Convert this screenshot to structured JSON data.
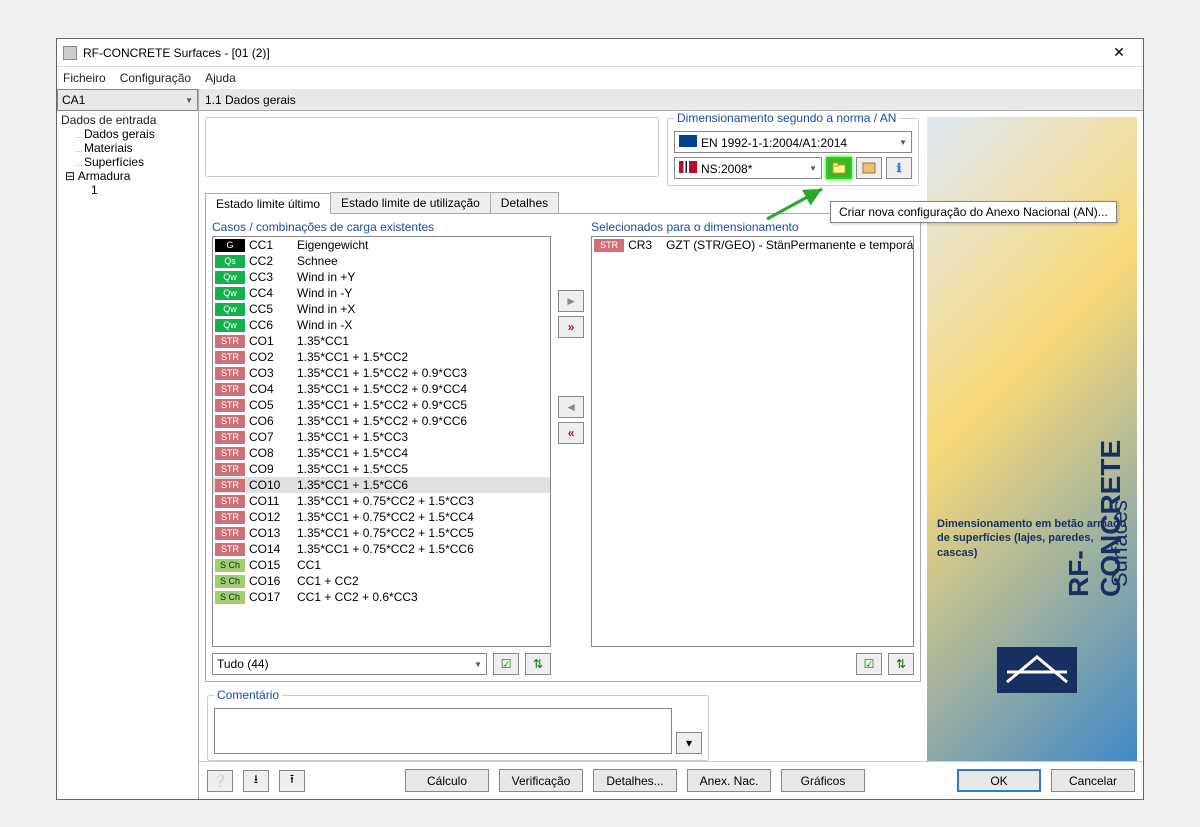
{
  "window": {
    "title": "RF-CONCRETE Surfaces - [01 (2)]"
  },
  "menu": {
    "file": "Ficheiro",
    "config": "Configuração",
    "help": "Ajuda"
  },
  "tree": {
    "selector": "CA1",
    "root": "Dados de entrada",
    "items": [
      "Dados gerais",
      "Materiais",
      "Superfícies"
    ],
    "armadura": "Armadura",
    "armadura_child": "1"
  },
  "page_title": "1.1 Dados gerais",
  "norm": {
    "legend": "Dimensionamento segundo a norma / AN",
    "standard": "EN 1992-1-1:2004/A1:2014",
    "annex": "NS:2008*",
    "tooltip": "Criar nova configuração do Anexo Nacional (AN)..."
  },
  "tabs": {
    "uls": "Estado limite último",
    "sls": "Estado limite de utilização",
    "details": "Detalhes"
  },
  "lists": {
    "existing_title": "Casos / combinações de carga existentes",
    "selected_title": "Selecionados para o dimensionamento",
    "filter": "Tudo (44)"
  },
  "load_cases": [
    {
      "badge": "G",
      "cls": "b-G",
      "code": "CC1",
      "desc": "Eigengewicht"
    },
    {
      "badge": "Qs",
      "cls": "b-Qs",
      "code": "CC2",
      "desc": "Schnee"
    },
    {
      "badge": "Qw",
      "cls": "b-Qw",
      "code": "CC3",
      "desc": "Wind in +Y"
    },
    {
      "badge": "Qw",
      "cls": "b-Qw",
      "code": "CC4",
      "desc": "Wind in -Y"
    },
    {
      "badge": "Qw",
      "cls": "b-Qw",
      "code": "CC5",
      "desc": "Wind in +X"
    },
    {
      "badge": "Qw",
      "cls": "b-Qw",
      "code": "CC6",
      "desc": "Wind in -X"
    },
    {
      "badge": "STR",
      "cls": "b-STR",
      "code": "CO1",
      "desc": "1.35*CC1"
    },
    {
      "badge": "STR",
      "cls": "b-STR",
      "code": "CO2",
      "desc": "1.35*CC1 + 1.5*CC2"
    },
    {
      "badge": "STR",
      "cls": "b-STR",
      "code": "CO3",
      "desc": "1.35*CC1 + 1.5*CC2 + 0.9*CC3"
    },
    {
      "badge": "STR",
      "cls": "b-STR",
      "code": "CO4",
      "desc": "1.35*CC1 + 1.5*CC2 + 0.9*CC4"
    },
    {
      "badge": "STR",
      "cls": "b-STR",
      "code": "CO5",
      "desc": "1.35*CC1 + 1.5*CC2 + 0.9*CC5"
    },
    {
      "badge": "STR",
      "cls": "b-STR",
      "code": "CO6",
      "desc": "1.35*CC1 + 1.5*CC2 + 0.9*CC6"
    },
    {
      "badge": "STR",
      "cls": "b-STR",
      "code": "CO7",
      "desc": "1.35*CC1 + 1.5*CC3"
    },
    {
      "badge": "STR",
      "cls": "b-STR",
      "code": "CO8",
      "desc": "1.35*CC1 + 1.5*CC4"
    },
    {
      "badge": "STR",
      "cls": "b-STR",
      "code": "CO9",
      "desc": "1.35*CC1 + 1.5*CC5"
    },
    {
      "badge": "STR",
      "cls": "b-STR",
      "code": "CO10",
      "desc": "1.35*CC1 + 1.5*CC6",
      "sel": true
    },
    {
      "badge": "STR",
      "cls": "b-STR",
      "code": "CO11",
      "desc": "1.35*CC1 + 0.75*CC2 + 1.5*CC3"
    },
    {
      "badge": "STR",
      "cls": "b-STR",
      "code": "CO12",
      "desc": "1.35*CC1 + 0.75*CC2 + 1.5*CC4"
    },
    {
      "badge": "STR",
      "cls": "b-STR",
      "code": "CO13",
      "desc": "1.35*CC1 + 0.75*CC2 + 1.5*CC5"
    },
    {
      "badge": "STR",
      "cls": "b-STR",
      "code": "CO14",
      "desc": "1.35*CC1 + 0.75*CC2 + 1.5*CC6"
    },
    {
      "badge": "S Ch",
      "cls": "b-SCh",
      "code": "CO15",
      "desc": "CC1"
    },
    {
      "badge": "S Ch",
      "cls": "b-SCh",
      "code": "CO16",
      "desc": "CC1 + CC2"
    },
    {
      "badge": "S Ch",
      "cls": "b-SCh",
      "code": "CO17",
      "desc": "CC1 + CC2 + 0.6*CC3"
    }
  ],
  "selected": [
    {
      "badge": "STR",
      "cls": "b-STR",
      "code": "CR3",
      "c1": "GZT (STR/GEO) - Stän",
      "c2": "Permanente e temporá"
    }
  ],
  "comment": {
    "legend": "Comentário"
  },
  "buttons": {
    "calc": "Cálculo",
    "verify": "Verificação",
    "details": "Detalhes...",
    "annex": "Anex. Nac.",
    "graphs": "Gráficos",
    "ok": "OK",
    "cancel": "Cancelar"
  },
  "banner": {
    "title": "RF-CONCRETE",
    "sub": "Surfaces",
    "desc": "Dimensionamento em betão armado de superfícies (lajes, paredes, cascas)"
  }
}
